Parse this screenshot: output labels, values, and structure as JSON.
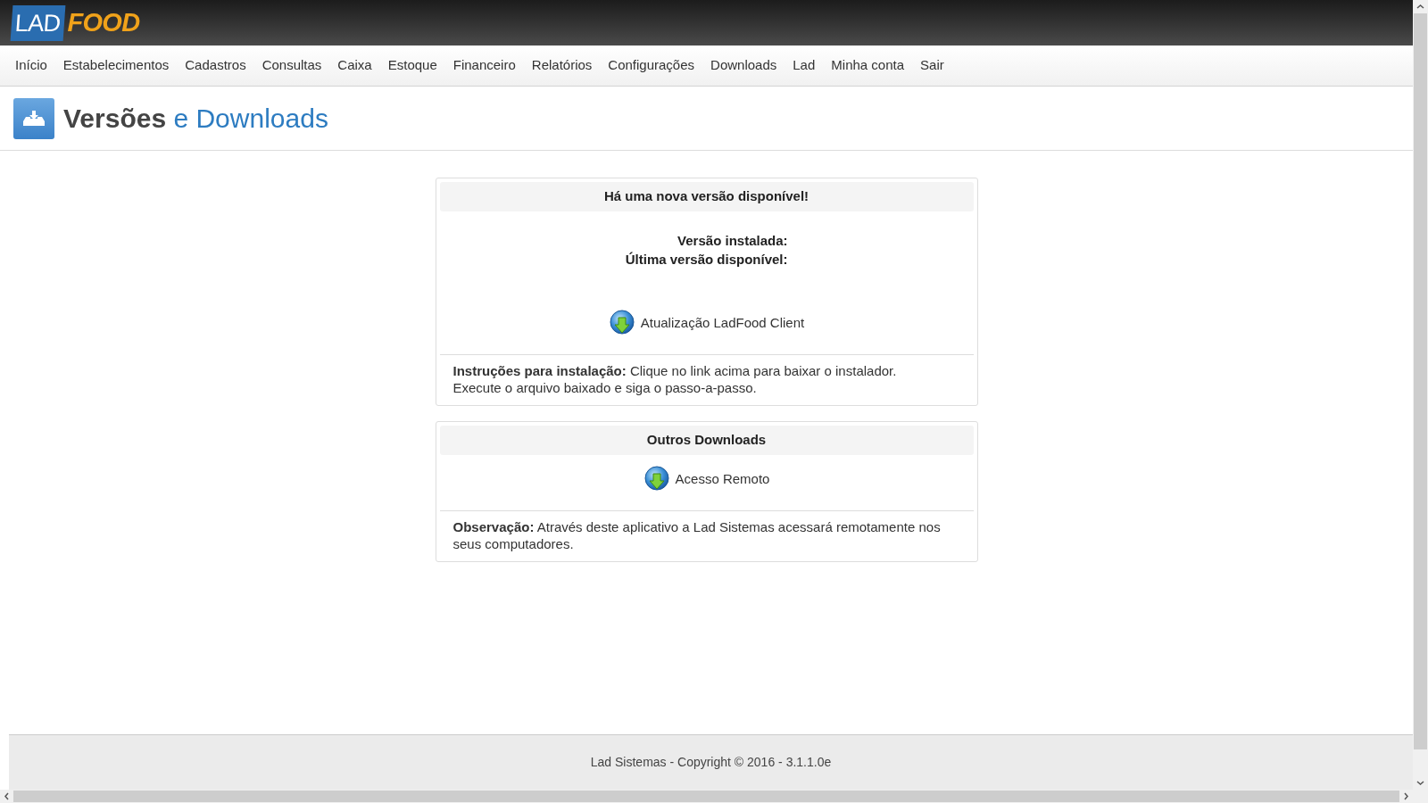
{
  "header": {
    "logo_left": "LAD",
    "logo_right": "FOOD"
  },
  "nav": [
    {
      "label": "Início"
    },
    {
      "label": "Estabelecimentos"
    },
    {
      "label": "Cadastros"
    },
    {
      "label": "Consultas"
    },
    {
      "label": "Caixa"
    },
    {
      "label": "Estoque"
    },
    {
      "label": "Financeiro"
    },
    {
      "label": "Relatórios"
    },
    {
      "label": "Configurações"
    },
    {
      "label": "Downloads"
    },
    {
      "label": "Lad"
    },
    {
      "label": "Minha conta"
    },
    {
      "label": "Sair"
    }
  ],
  "page_title": {
    "main": "Versões",
    "accent": "e Downloads"
  },
  "update_card": {
    "title": "Há uma nova versão disponível!",
    "fields": [
      "Versão instalada:",
      "Última versão disponível:"
    ],
    "link": "Atualização LadFood Client",
    "note_lines": [
      "**Instruções para instalação:** Clique no link acima para baixar o instalador.",
      "Execute o arquivo baixado e siga o passo-a-passo."
    ]
  },
  "other_card": {
    "title": "Outros Downloads",
    "link": "Acesso Remoto",
    "note_lines": [
      "**Observação:** Através deste aplicativo a Lad Sistemas acessará remotamente nos",
      "seus computadores."
    ]
  },
  "footer": "Lad Sistemas - Copyright © 2016 - 3.1.1.0e"
}
